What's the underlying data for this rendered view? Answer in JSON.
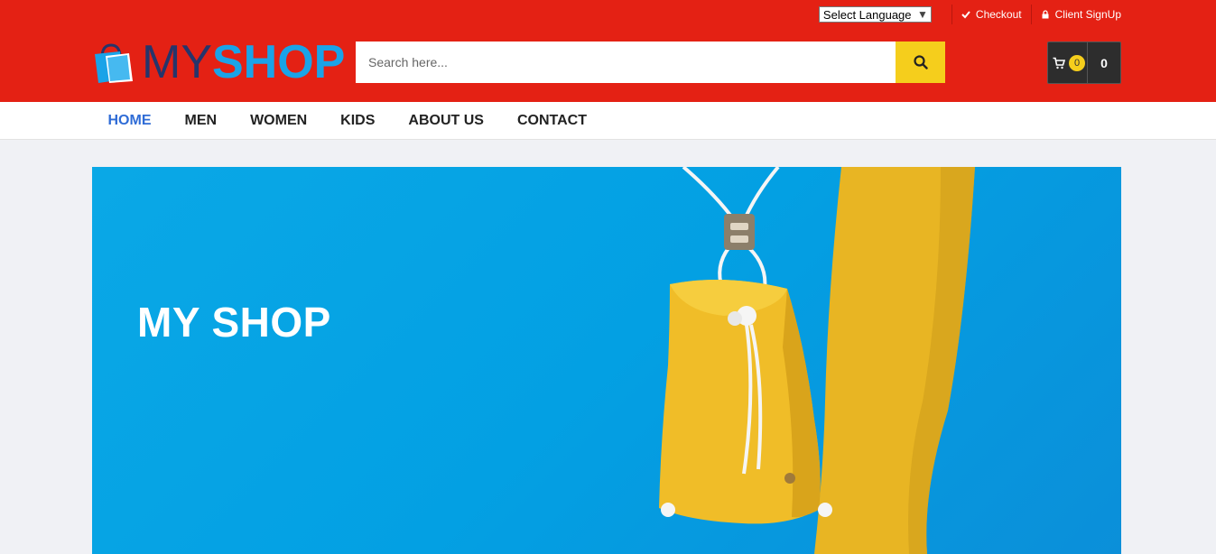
{
  "topbar": {
    "language_label": "Select Language",
    "checkout_label": "Checkout",
    "signup_label": "Client SignUp"
  },
  "logo": {
    "my": "MY",
    "shop": "SHOP"
  },
  "search": {
    "placeholder": "Search here..."
  },
  "cart": {
    "count": "0",
    "total": "0"
  },
  "nav": {
    "items": [
      "HOME",
      "MEN",
      "WOMEN",
      "KIDS",
      "ABOUT US",
      "CONTACT"
    ],
    "active": "HOME"
  },
  "hero": {
    "title": "MY SHOP"
  },
  "colors": {
    "header_red": "#e42114",
    "accent_yellow": "#f5ce1c",
    "nav_active": "#2f6cd6",
    "hero_blue": "#03a0e3"
  }
}
